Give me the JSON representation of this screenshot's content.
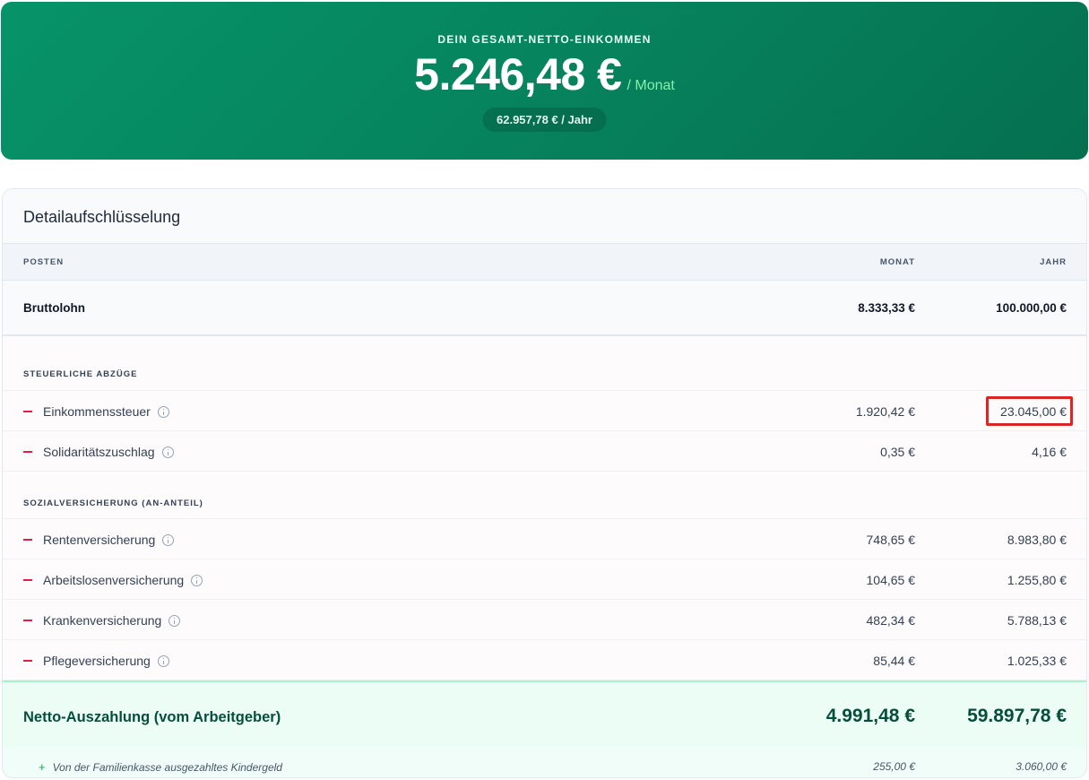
{
  "hero": {
    "label": "DEIN GESAMT-NETTO-EINKOMMEN",
    "amount": "5.246,48 €",
    "unit": "/ Monat",
    "yearly": "62.957,78 € / Jahr"
  },
  "card": {
    "title": "Detailaufschlüsselung",
    "columns": {
      "item": "POSTEN",
      "month": "MONAT",
      "year": "JAHR"
    },
    "gross": {
      "label": "Bruttolohn",
      "month": "8.333,33 €",
      "year": "100.000,00 €"
    },
    "tax_section": {
      "title": "STEUERLICHE ABZÜGE",
      "items": [
        {
          "label": "Einkommenssteuer",
          "month": "1.920,42 €",
          "year": "23.045,00 €"
        },
        {
          "label": "Solidaritätszuschlag",
          "month": "0,35 €",
          "year": "4,16 €"
        }
      ]
    },
    "social_section": {
      "title": "SOZIALVERSICHERUNG (AN-ANTEIL)",
      "items": [
        {
          "label": "Rentenversicherung",
          "month": "748,65 €",
          "year": "8.983,80 €"
        },
        {
          "label": "Arbeitslosenversicherung",
          "month": "104,65 €",
          "year": "1.255,80 €"
        },
        {
          "label": "Krankenversicherung",
          "month": "482,34 €",
          "year": "5.788,13 €"
        },
        {
          "label": "Pflegeversicherung",
          "month": "85,44 €",
          "year": "1.025,33 €"
        }
      ]
    },
    "net": {
      "label": "Netto-Auszahlung (vom Arbeitgeber)",
      "month": "4.991,48 €",
      "year": "59.897,78 €"
    },
    "kindergeld": {
      "label": "Von der Familienkasse ausgezahltes Kindergeld",
      "month": "255,00 €",
      "year": "3.060,00 €"
    }
  },
  "colors": {
    "hero_start": "#079368",
    "hero_end": "#05704f",
    "minus": "#e11d48",
    "highlight": "#dc2626",
    "net_text": "#064e3b"
  }
}
